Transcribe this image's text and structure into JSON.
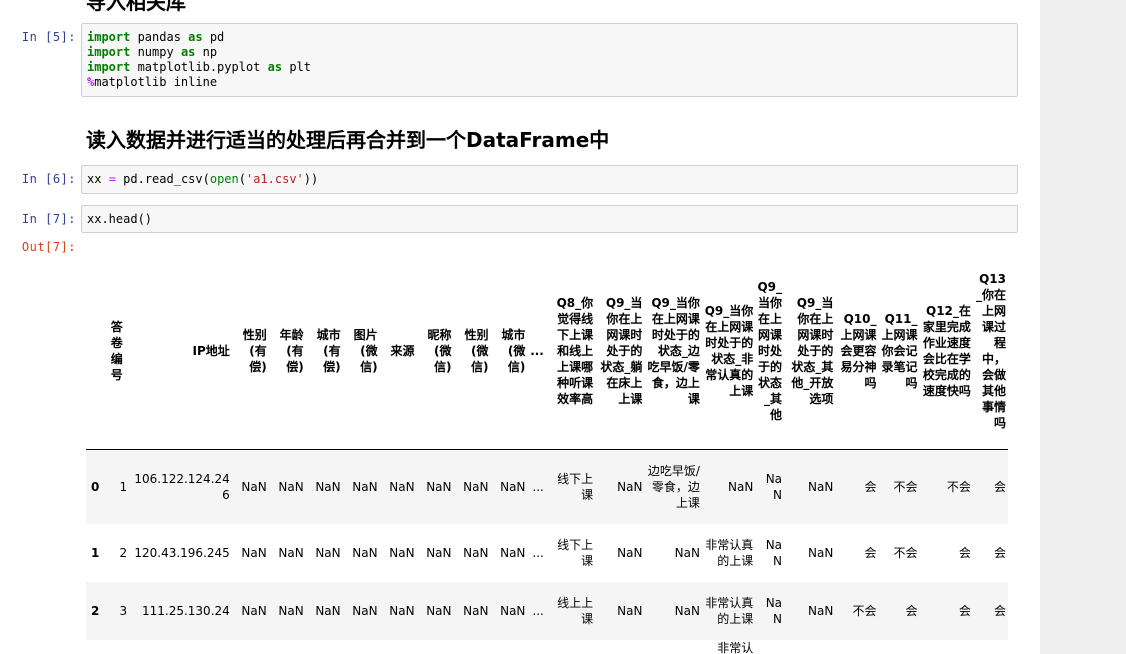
{
  "notebook": {
    "heading_top": "导入相关库",
    "cell5": {
      "prompt": "In  [5]:",
      "lines": [
        [
          {
            "t": "import",
            "c": "kw"
          },
          {
            "t": " pandas ",
            "c": ""
          },
          {
            "t": "as",
            "c": "kw"
          },
          {
            "t": " pd",
            "c": ""
          }
        ],
        [
          {
            "t": "import",
            "c": "kw"
          },
          {
            "t": " numpy ",
            "c": ""
          },
          {
            "t": "as",
            "c": "kw"
          },
          {
            "t": " np",
            "c": ""
          }
        ],
        [
          {
            "t": "import",
            "c": "kw"
          },
          {
            "t": " matplotlib.pyplot ",
            "c": ""
          },
          {
            "t": "as",
            "c": "kw"
          },
          {
            "t": " plt",
            "c": ""
          }
        ],
        [
          {
            "t": "%",
            "c": "mg"
          },
          {
            "t": "matplotlib inline",
            "c": ""
          }
        ]
      ]
    },
    "heading2": "读入数据并进行适当的处理后再合并到一个DataFrame中",
    "cell6": {
      "prompt": "In  [6]:",
      "lines": [
        [
          {
            "t": "xx ",
            "c": ""
          },
          {
            "t": "=",
            "c": "op"
          },
          {
            "t": " pd.read_csv(",
            "c": ""
          },
          {
            "t": "open",
            "c": "kw2"
          },
          {
            "t": "(",
            "c": ""
          },
          {
            "t": "'a1.csv'",
            "c": "str"
          },
          {
            "t": "))",
            "c": ""
          }
        ]
      ]
    },
    "cell7": {
      "prompt": "In  [7]:",
      "lines": [
        [
          {
            "t": "xx.head()",
            "c": ""
          }
        ]
      ]
    },
    "out7_prompt": "Out[7]:"
  },
  "table": {
    "columns": [
      "",
      "答卷编号",
      "IP地址",
      "性别(有偿)",
      "年龄(有偿)",
      "城市(有偿)",
      "图片(微信)",
      "来源",
      "昵称(微信)",
      "性别(微信)",
      "城市(微信)",
      "...",
      "Q8_你觉得线下上课和线上上课哪种听课效率高",
      "Q9_当你在上网课时处于的状态_躺在床上上课",
      "Q9_当你在上网课时处于的状态_边吃早饭/零食，边上课",
      "Q9_当你在上网课时处于的状态_非常认真的上课",
      "Q9_当你在上网课时处于的状态_其他",
      "Q9_当你在上网课时处于的状态_其他_开放选项",
      "Q10_上网课会更容易分神吗",
      "Q11_上网课你会记录笔记吗",
      "Q12_在家里完成作业速度会比在学校完成的速度快吗",
      "Q13_你在上网课过程中，会做其他事情吗"
    ],
    "rows": [
      [
        "0",
        "1",
        "106.122.124.246",
        "NaN",
        "NaN",
        "NaN",
        "NaN",
        "NaN",
        "NaN",
        "NaN",
        "NaN",
        "...",
        "线下上课",
        "NaN",
        "边吃早饭/零食，边上课",
        "NaN",
        "NaN",
        "NaN",
        "会",
        "不会",
        "不会",
        "会"
      ],
      [
        "1",
        "2",
        "120.43.196.245",
        "NaN",
        "NaN",
        "NaN",
        "NaN",
        "NaN",
        "NaN",
        "NaN",
        "NaN",
        "...",
        "线下上课",
        "NaN",
        "NaN",
        "非常认真的上课",
        "NaN",
        "NaN",
        "会",
        "不会",
        "会",
        "会"
      ],
      [
        "2",
        "3",
        "111.25.130.24",
        "NaN",
        "NaN",
        "NaN",
        "NaN",
        "NaN",
        "NaN",
        "NaN",
        "NaN",
        "...",
        "线上上课",
        "NaN",
        "NaN",
        "非常认真的上课",
        "NaN",
        "NaN",
        "不会",
        "会",
        "会",
        "会"
      ],
      [
        "",
        "",
        "",
        "",
        "",
        "",
        "",
        "",
        "",
        "",
        "",
        "",
        "",
        "",
        "",
        "非常认",
        "",
        "",
        "",
        "",
        "",
        ""
      ]
    ]
  },
  "colors": {
    "in_prompt": "#303f9f",
    "out_prompt": "#d84315",
    "keyword": "#008000",
    "string": "#ba2121",
    "magic": "#aa22ff"
  }
}
